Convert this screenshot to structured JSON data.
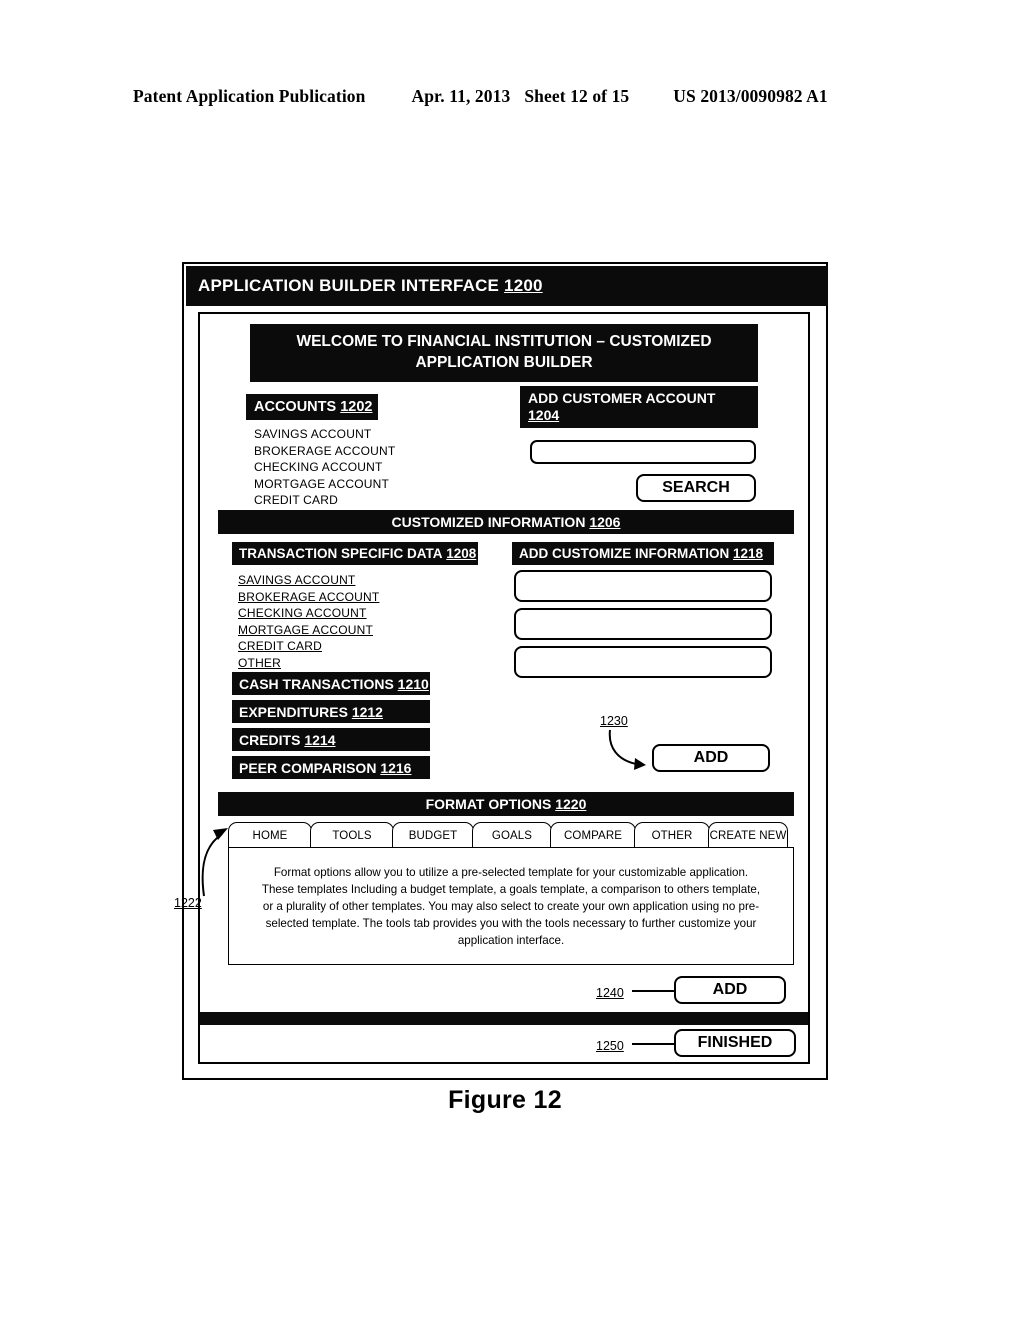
{
  "publication_header": {
    "left": "Patent Application Publication",
    "date": "Apr. 11, 2013",
    "sheet": "Sheet 12 of 15",
    "number": "US 2013/0090982 A1"
  },
  "interface": {
    "title": "APPLICATION BUILDER INTERFACE",
    "title_ref": "1200",
    "welcome_line1": "WELCOME TO FINANCIAL INSTITUTION – CUSTOMIZED",
    "welcome_line2": "APPLICATION BUILDER"
  },
  "accounts": {
    "header_label": "ACCOUNTS",
    "header_ref": "1202",
    "items": [
      "SAVINGS ACCOUNT",
      "BROKERAGE ACCOUNT",
      "CHECKING ACCOUNT",
      "MORTGAGE ACCOUNT",
      "CREDIT CARD"
    ]
  },
  "add_customer_account": {
    "header_label": "ADD CUSTOMER ACCOUNT",
    "header_ref": "1204",
    "search_value": "",
    "search_placeholder": "",
    "search_button": "SEARCH"
  },
  "customized_information": {
    "header_label": "CUSTOMIZED INFORMATION",
    "header_ref": "1206"
  },
  "transaction_specific_data": {
    "header_label": "TRANSACTION SPECIFIC DATA",
    "header_ref": "1208",
    "items": [
      "SAVINGS ACCOUNT",
      "BROKERAGE ACCOUNT",
      "CHECKING ACCOUNT",
      "MORTGAGE ACCOUNT",
      "CREDIT CARD",
      "OTHER"
    ],
    "categories": [
      {
        "label": "CASH TRANSACTIONS",
        "ref": "1210"
      },
      {
        "label": "EXPENDITURES",
        "ref": "1212"
      },
      {
        "label": "CREDITS",
        "ref": "1214"
      },
      {
        "label": "PEER COMPARISON",
        "ref": "1216"
      }
    ]
  },
  "add_customize_information": {
    "header_label": "ADD CUSTOMIZE INFORMATION",
    "header_ref": "1218",
    "field_1": "",
    "field_2": "",
    "field_3": "",
    "add_button": "ADD",
    "add_ref": "1230"
  },
  "format_options": {
    "header_label": "FORMAT OPTIONS",
    "header_ref": "1220",
    "tabs_ref": "1222",
    "tabs": [
      "HOME",
      "TOOLS",
      "BUDGET",
      "GOALS",
      "COMPARE",
      "OTHER",
      "CREATE NEW"
    ],
    "description": "Format options allow you to utilize a pre-selected template for your customizable application.  These templates Including a budget template, a goals template, a comparison to others template, or a plurality of other templates.  You may also select to create your own application using no pre-selected template.  The tools tab provides you with the tools necessary to further customize your application interface."
  },
  "footer_actions": {
    "add_label": "ADD",
    "add_ref": "1240",
    "finished_label": "FINISHED",
    "finished_ref": "1250"
  },
  "figure_caption": "Figure 12"
}
